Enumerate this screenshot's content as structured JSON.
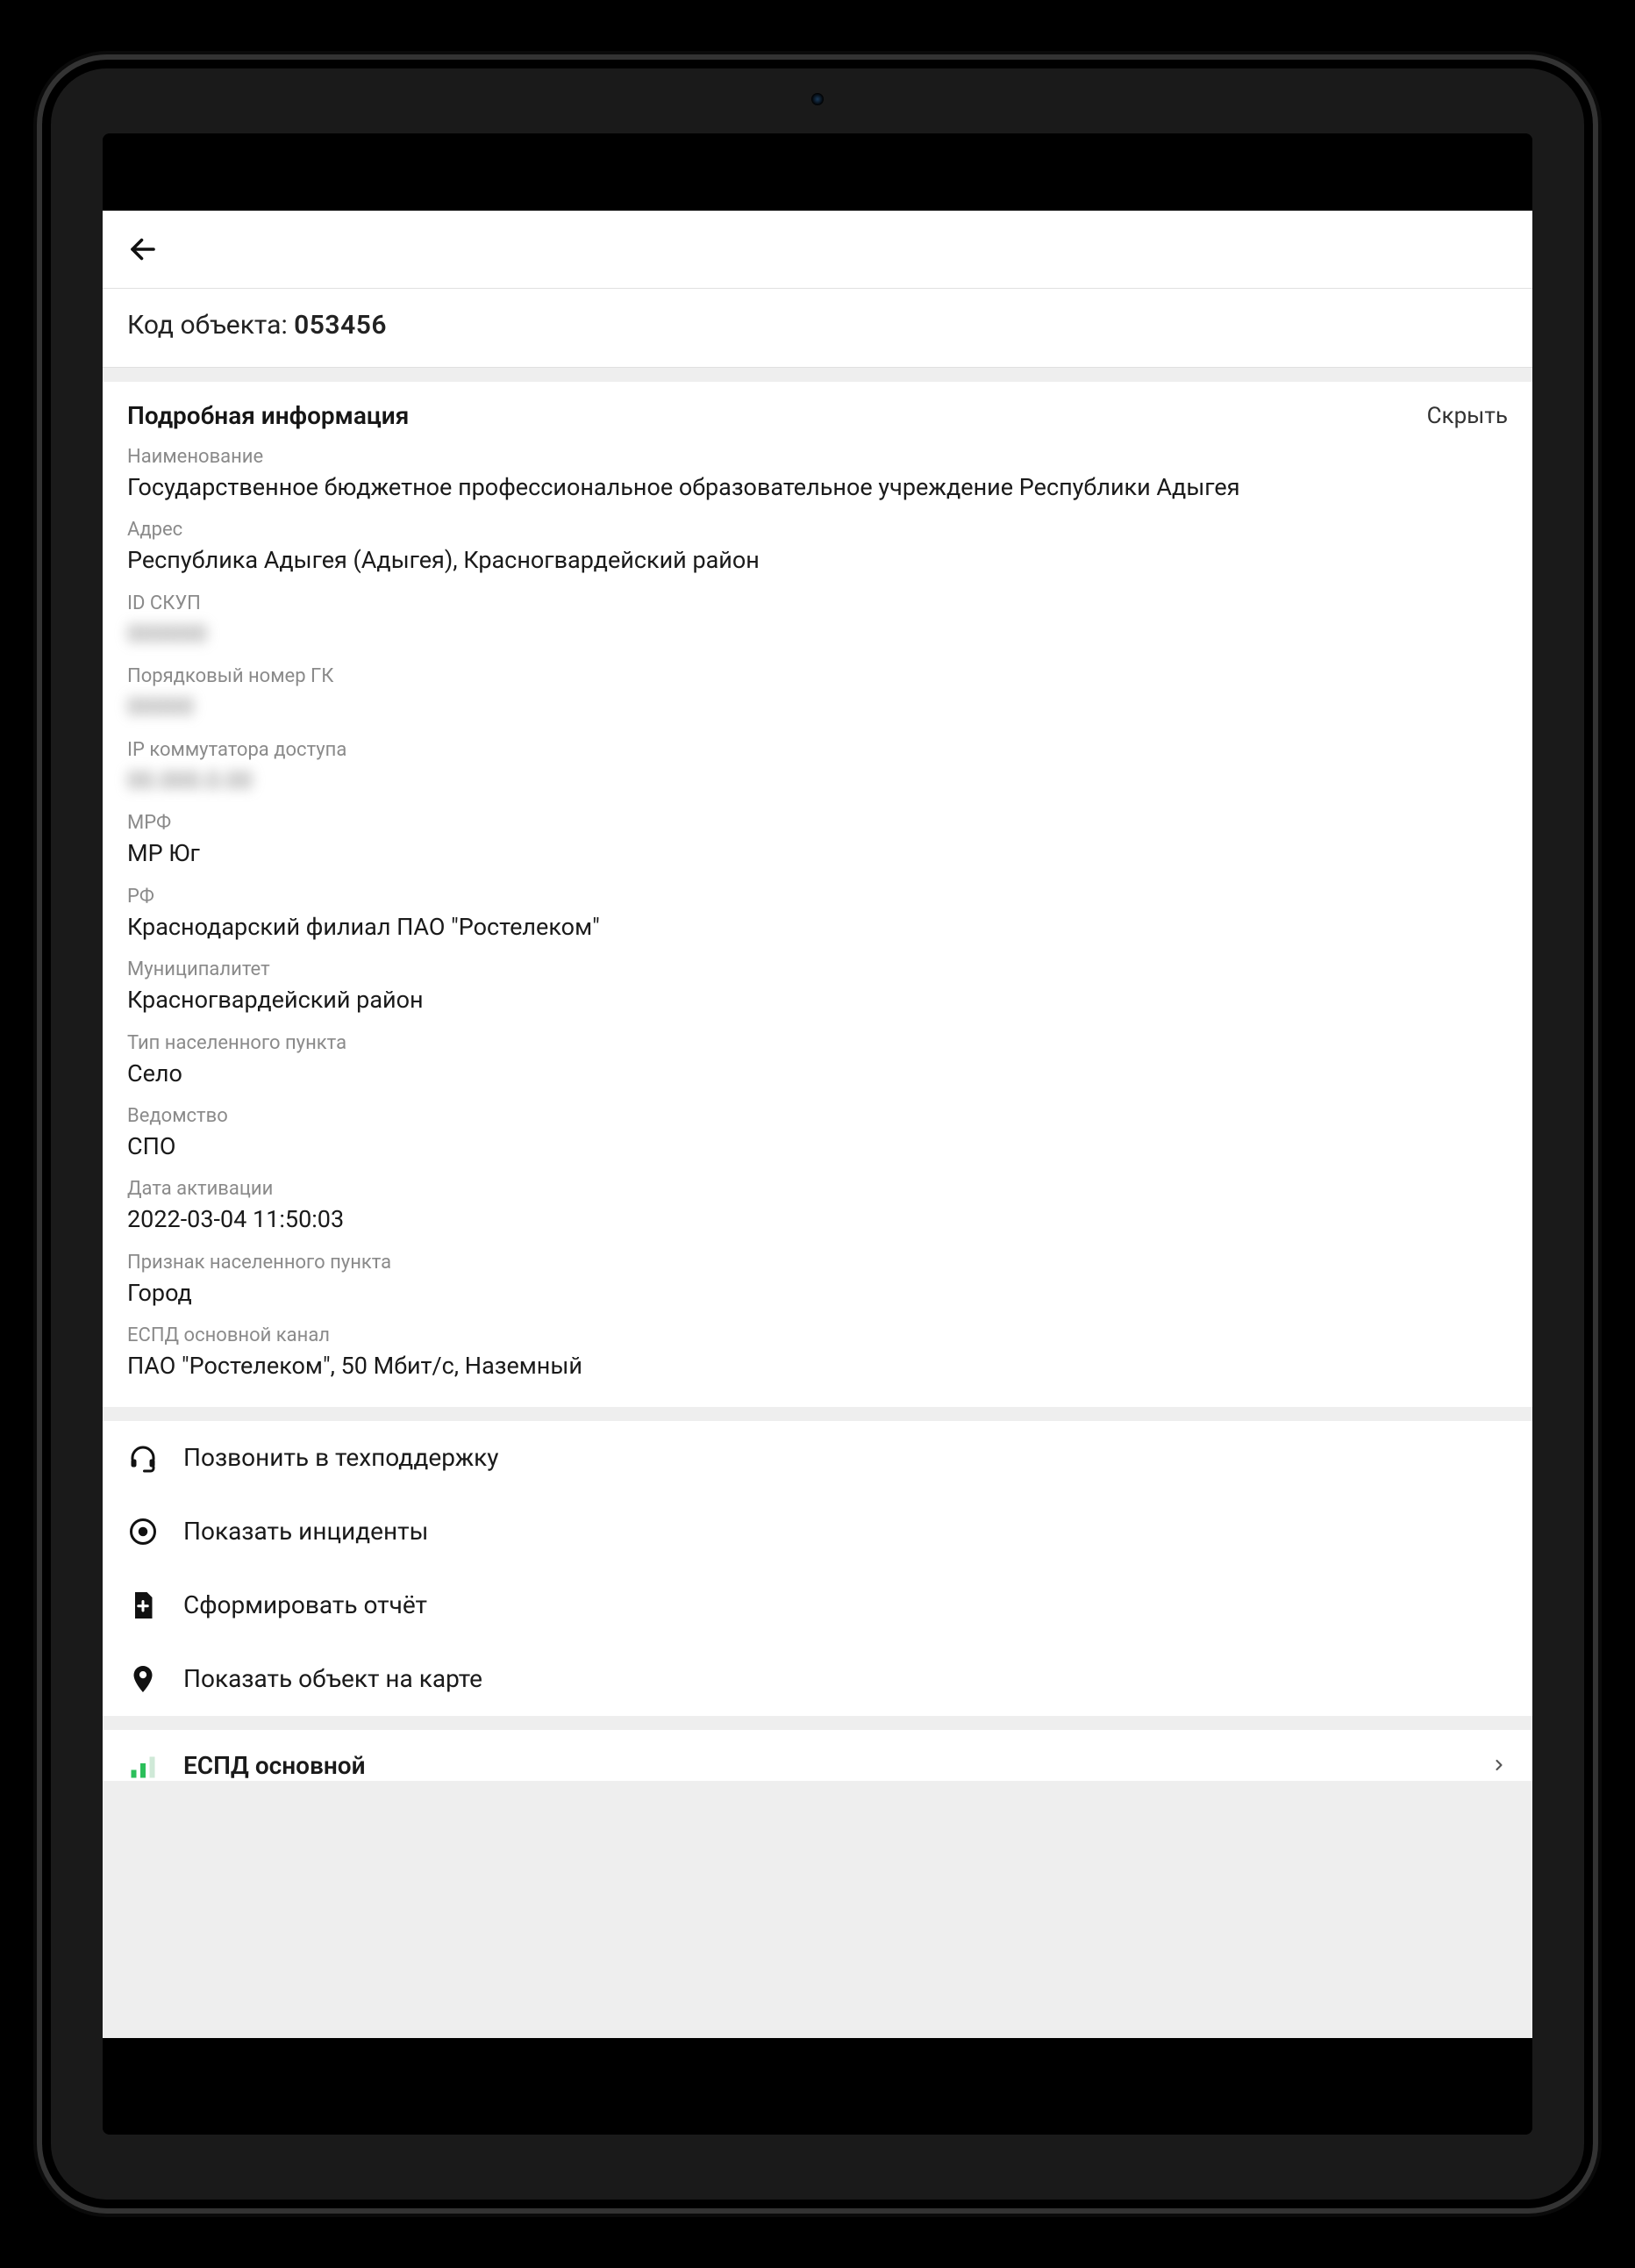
{
  "header": {
    "code_label": "Код объекта: ",
    "code_value": "053456"
  },
  "details": {
    "title": "Подробная информация",
    "hide_label": "Скрыть",
    "fields": {
      "name_label": "Наименование",
      "name_value": "Государственное бюджетное профессиональное образовательное учреждение Республики Адыгея",
      "address_label": "Адрес",
      "address_value": "Республика Адыгея (Адыгея), Красногвардейский район",
      "id_skup_label": "ID СКУП",
      "id_skup_value": "000000",
      "gk_num_label": "Порядковый номер ГК",
      "gk_num_value": "00000",
      "ip_label": "IP коммутатора доступа",
      "ip_value": "00.000.0.00",
      "mrf_label": "МРФ",
      "mrf_value": "МР Юг",
      "rf_label": "РФ",
      "rf_value": "Краснодарский филиал ПАО \"Ростелеком\"",
      "muni_label": "Муниципалитет",
      "muni_value": "Красногвардейский район",
      "settle_type_label": "Тип населенного пункта",
      "settle_type_value": "Село",
      "agency_label": "Ведомство",
      "agency_value": "СПО",
      "activation_label": "Дата активации",
      "activation_value": "2022-03-04 11:50:03",
      "settle_flag_label": "Признак населенного пункта",
      "settle_flag_value": "Город",
      "espd_label": "ЕСПД основной канал",
      "espd_value": "ПАО \"Ростелеком\", 50 Мбит/с, Наземный"
    }
  },
  "actions": {
    "call_support": "Позвонить в техподдержку",
    "show_incidents": "Показать инциденты",
    "generate_report": "Сформировать отчёт",
    "show_on_map": "Показать объект на карте"
  },
  "bottom": {
    "espd_main": "ЕСПД основной"
  }
}
